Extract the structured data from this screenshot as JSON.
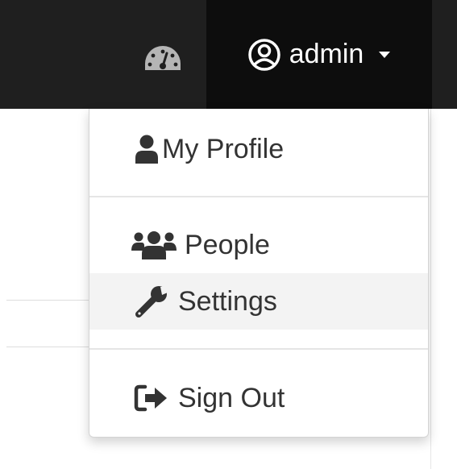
{
  "navbar": {
    "dashboard_icon": "dashboard-icon",
    "user": {
      "icon": "user-circle-icon",
      "label": "admin",
      "caret": "caret-down-icon"
    }
  },
  "dropdown": {
    "items": [
      {
        "label": "My Profile",
        "icon": "user-icon"
      },
      {
        "label": "People",
        "icon": "users-icon"
      },
      {
        "label": "Settings",
        "icon": "wrench-icon"
      },
      {
        "label": "Sign Out",
        "icon": "sign-out-icon"
      }
    ]
  },
  "colors": {
    "navbar_bg": "#1f1f1f",
    "user_menu_bg": "#0d0d0d",
    "text": "#333333",
    "active_bg": "#f3f3f3"
  }
}
